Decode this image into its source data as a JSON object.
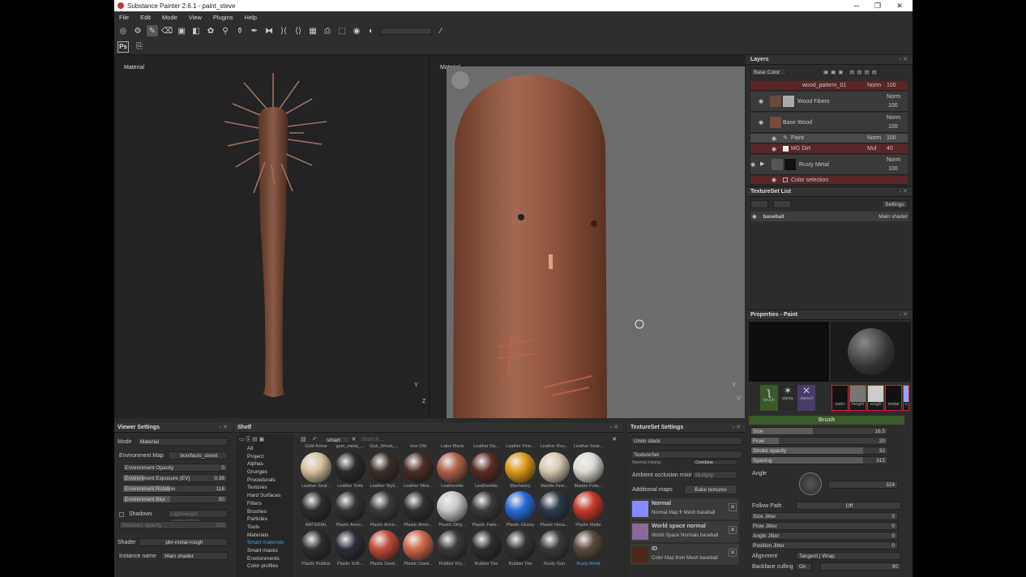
{
  "window": {
    "title": "Substance Painter 2.6.1 - paint_steve",
    "min": "─",
    "max": "❐",
    "close": "✕"
  },
  "menu": [
    "File",
    "Edit",
    "Mode",
    "View",
    "Plugins",
    "Help"
  ],
  "toolbar": {
    "ps_label": "Ps"
  },
  "viewport": {
    "left_label": "Material",
    "right_label": "Material",
    "axis_y": "Y",
    "axis_z": "Z",
    "axis_u": "U"
  },
  "layers": {
    "title": "Layers",
    "channel": "Base Color",
    "items": [
      {
        "name": "wood_pattern_01",
        "blend": "Norm",
        "opacity": "100"
      },
      {
        "name": "Wood Fibers",
        "blend": "Norm",
        "opacity": "100"
      },
      {
        "name": "Base Wood",
        "blend": "Norm",
        "opacity": "100"
      },
      {
        "name": "Paint",
        "blend": "Norm",
        "opacity": "100"
      },
      {
        "name": "MG Dirt",
        "blend": "Mul",
        "opacity": "40"
      },
      {
        "name": "Rusty Metal",
        "blend": "Norm",
        "opacity": "100"
      },
      {
        "name": "Color selection",
        "blend": "",
        "opacity": ""
      }
    ]
  },
  "textureset_list": {
    "title": "TextureSet List",
    "settings": "Settings",
    "item": "baseball",
    "shader": "Main shader"
  },
  "properties": {
    "title": "Properties - Paint",
    "chips": [
      "brush",
      "alpha",
      "stencil"
    ],
    "channels": [
      "color",
      "height",
      "rough",
      "metal",
      "n"
    ],
    "brush_header": "Brush",
    "sliders": [
      {
        "label": "Size",
        "value": "16.5",
        "fill": 0.45
      },
      {
        "label": "Flow",
        "value": "20",
        "fill": 0.2
      },
      {
        "label": "Stroke opacity",
        "value": "32",
        "fill": 0.82
      },
      {
        "label": "Spacing",
        "value": "315",
        "fill": 0.82
      }
    ],
    "angle_label": "Angle",
    "angle_value": "324",
    "follow_path_label": "Follow Path",
    "follow_path_value": "Off",
    "jitters": [
      {
        "label": "Size Jitter",
        "value": "0"
      },
      {
        "label": "Flow Jitter",
        "value": "0"
      },
      {
        "label": "Angle Jitter",
        "value": "0"
      },
      {
        "label": "Position Jitter",
        "value": "0"
      }
    ],
    "alignment_label": "Alignment",
    "alignment_value": "Tangent | Wrap",
    "backface_label": "Backface culling",
    "backface_value": "On",
    "backface_num": "90"
  },
  "viewer_settings": {
    "title": "Viewer Settings",
    "mode_label": "Mode",
    "mode_value": "Material",
    "env_map_label": "Environment Map",
    "env_map_value": "bonifacio_street",
    "sliders": [
      {
        "label": "Environment Opacity",
        "value": "0"
      },
      {
        "label": "Environment Exposure (EV)",
        "value": "0.38"
      },
      {
        "label": "Environment Rotation",
        "value": "118"
      },
      {
        "label": "Environment Blur",
        "value": "50"
      }
    ],
    "shadows_label": "Shadows",
    "shadows_value": "Lightweight computation",
    "shadows_opacity_label": "Shadows opacity",
    "shadows_opacity_value": "100",
    "shader_label": "Shader",
    "shader_value": "pbr-metal-rough",
    "instance_label": "Instance name",
    "instance_value": "Main shader"
  },
  "shelf": {
    "title": "Shelf",
    "filter_tag": "smart",
    "search_placeholder": "Search...",
    "categories": [
      "All",
      "Project",
      "Alphas",
      "Grunges",
      "Procedurals",
      "Textures",
      "Hard Surfaces",
      "Filters",
      "Brushes",
      "Particles",
      "Tools",
      "Materials",
      "Smart materials",
      "Smart masks",
      "Environments",
      "Color profiles"
    ],
    "selected_category": "Smart materials",
    "top_names": [
      "Gold Armor",
      "gum_metal_...",
      "Gun_Wood_...",
      "Iron Old",
      "Latex Black",
      "Leather Da...",
      "Leather Fine...",
      "Leather Rou...",
      "Leather Seat..."
    ],
    "rows": [
      {
        "names": [
          "Leather Seat...",
          "Leather Sofa",
          "Leather Styli...",
          "Leather Wea...",
          "Leatherette",
          "Leatherette",
          "Machinery",
          "Marble Fine...",
          "Marble Polis..."
        ],
        "colors": [
          "#d8c3a0",
          "#2a2a2a",
          "#3a2e28",
          "#4a2e26",
          "#b0614a",
          "#5a2c24",
          "#e09a1a",
          "#d8c8b0",
          "#e0dcd4"
        ]
      },
      {
        "names": [
          "MATERIAL",
          "Plastic Armo...",
          "Plastic Armo...",
          "Plastic Armo...",
          "Plastic Dirty...",
          "Plastic Fake...",
          "Plastic Glossy",
          "Plastic Hexa...",
          "Plastic Matte"
        ],
        "colors": [
          "#2c2c2c",
          "#333",
          "#3a3a3a",
          "#2f2f2f",
          "#c8c8c8",
          "#3a3a3a",
          "#2a6ad8",
          "#2a3a4a",
          "#c83a2a"
        ]
      },
      {
        "names": [
          "Plastic Rubber",
          "Plastic Soft...",
          "Plastic Used...",
          "Plastic Used...",
          "Rubber Dry...",
          "Rubber Tire",
          "Rubber Tire",
          "Rusty Gun",
          "Rusty Metal"
        ],
        "colors": [
          "#2e2e2e",
          "#2a2c3a",
          "#c04a3a",
          "#d06848",
          "#3a3a3a",
          "#2e2e2e",
          "#333",
          "#3a3a3a",
          "#5a4a3a"
        ]
      }
    ]
  },
  "tss": {
    "title": "TextureSet Settings",
    "undo": "Undo stack",
    "textureset": "TextureSet",
    "normal_mixing_label": "Normal mixing",
    "normal_mixing_value": "Combine",
    "ao_label": "Ambient occlusion mixing",
    "ao_value": "Multiply",
    "additional_maps": "Additional maps",
    "bake": "Bake textures",
    "maps": [
      {
        "name": "Normal",
        "desc": "Normal Map fr  Mesh baseball",
        "color": "#8a8aff"
      },
      {
        "name": "World space normal",
        "desc": "World Space Normals baseball",
        "color": "#8a6a9a"
      },
      {
        "name": "ID",
        "desc": "Color Map from Mesh baseball",
        "color": "#4a2a1a"
      }
    ]
  },
  "colors": {
    "accent": "#3fa4e0",
    "brush_green": "#3a5a2a",
    "layer_red": "#5a2626"
  }
}
